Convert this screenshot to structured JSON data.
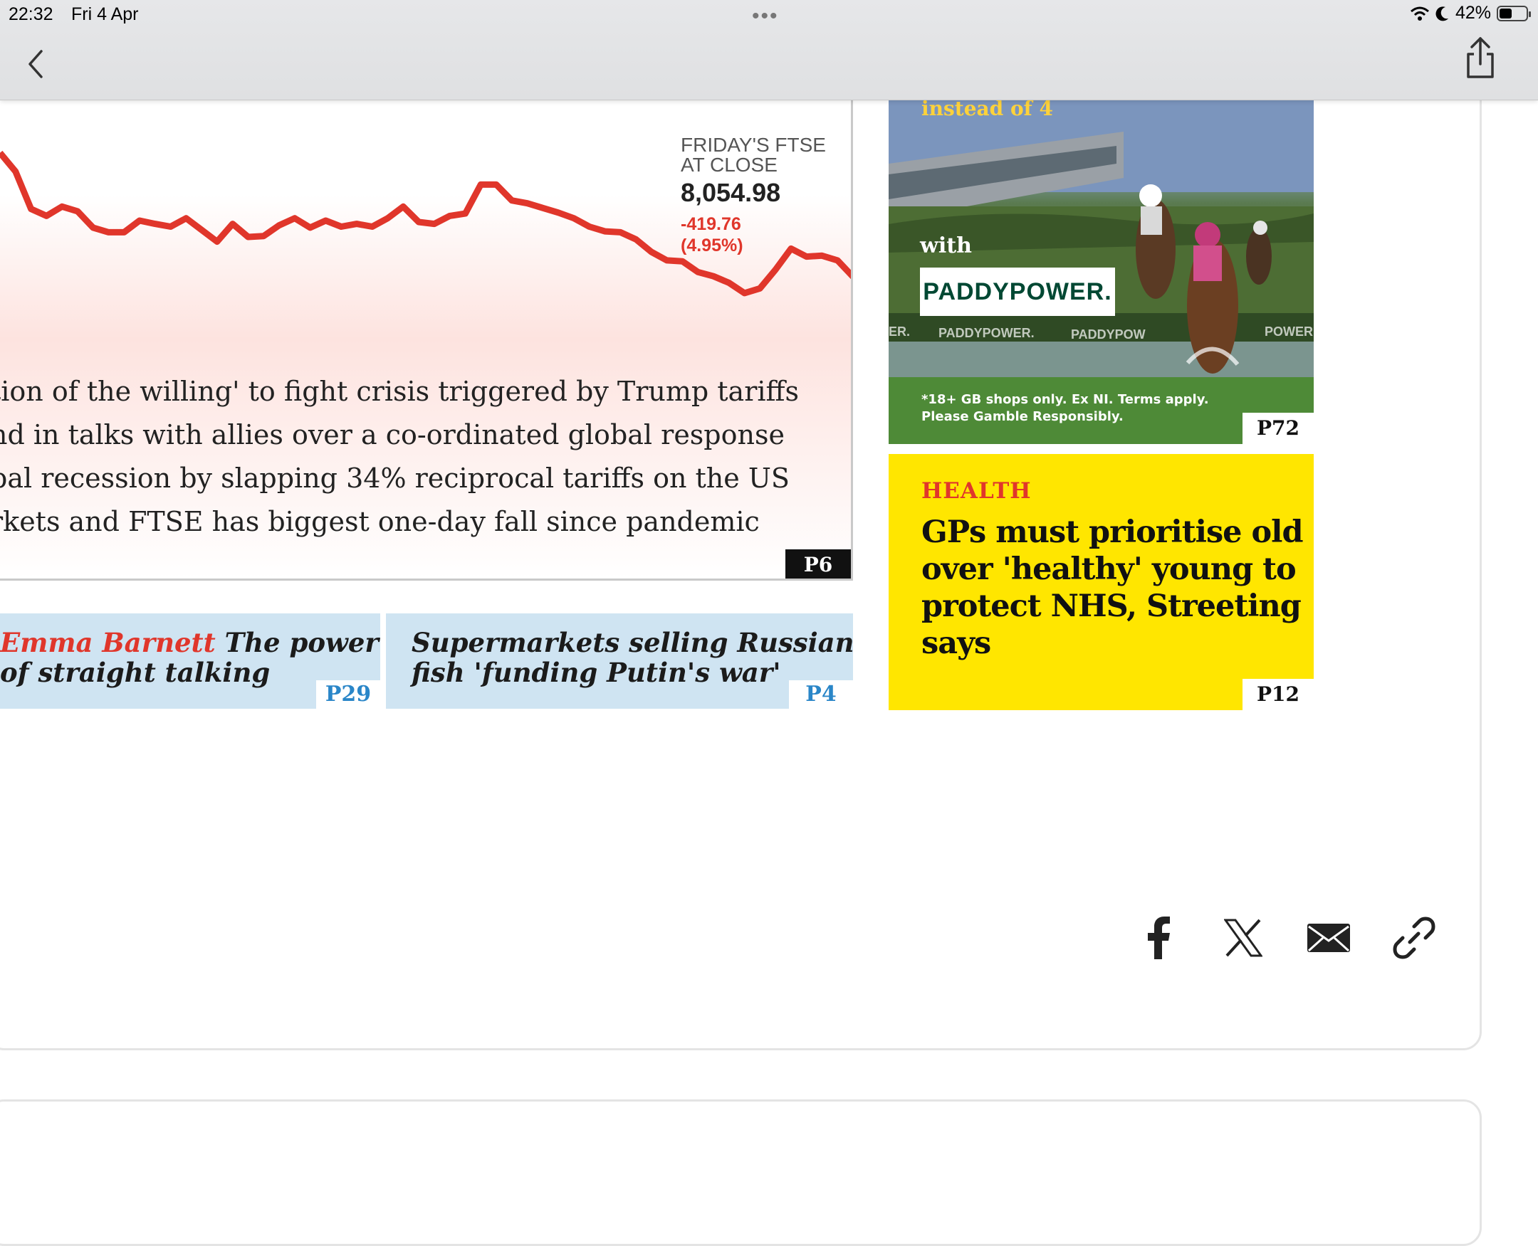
{
  "status_bar": {
    "time": "22:32",
    "date": "Fri 4 Apr",
    "battery": "42%",
    "battery_level": 0.42
  },
  "nav": {
    "back_icon": "chevron-left-icon",
    "share_icon": "share-icon"
  },
  "chart_panel": {
    "ftse_label": "FRIDAY'S FTSE AT CLOSE",
    "ftse_value": "8,054.98",
    "ftse_change": "-419.76",
    "ftse_change_pct": "(4.95%)",
    "line_color": "#e0362b",
    "story_lines": [
      "tion of the willing' to fight crisis triggered by Trump tariffs",
      "nd in talks with allies over a co-ordinated global response",
      "bal recession by slapping 34% reciprocal tariffs on the US",
      "rkets and FTSE has biggest one-day fall since pandemic"
    ],
    "page": "P6"
  },
  "chart_data": {
    "type": "line",
    "title": "",
    "xlabel": "",
    "ylabel": "",
    "series": [
      {
        "values": [
          8470,
          8430,
          8350,
          8335,
          8355,
          8345,
          8310,
          8300,
          8300,
          8325,
          8318,
          8312,
          8330,
          8305,
          8280,
          8318,
          8290,
          8292,
          8315,
          8330,
          8310,
          8325,
          8312,
          8318,
          8312,
          8330,
          8355,
          8322,
          8318,
          8335,
          8340,
          8402,
          8402,
          8368,
          8362,
          8352,
          8342,
          8330,
          8312,
          8302,
          8300,
          8285,
          8258,
          8240,
          8238,
          8215,
          8206,
          8192,
          8170,
          8180,
          8220,
          8265,
          8248,
          8250,
          8240,
          8205
        ]
      }
    ],
    "grid": false,
    "legend": "none"
  },
  "teasers": [
    {
      "author": "Emma Barnett",
      "text_1": "The power",
      "text_2": "of straight talking",
      "page": "P29"
    },
    {
      "text_1": "Supermarkets selling Russian",
      "text_2": "fish 'funding Putin's war'",
      "page": "P4"
    }
  ],
  "ad": {
    "headline": "instead of 4",
    "with": "with",
    "logo": "PADDYPOWER.",
    "logo_small_1": "PADDYPOWER.",
    "logo_small_2": "PADDYPOW",
    "logo_small_3": "POWER.",
    "logo_small_0": "ER.",
    "fine_1": "*18+ GB shops only. Ex NI. Terms apply.",
    "fine_2": "Please Gamble Responsibly.",
    "page": "P72"
  },
  "health": {
    "label": "HEALTH",
    "headline": "GPs must prioritise old over 'healthy' young to protect NHS, Streeting says",
    "page": "P12"
  },
  "share": [
    {
      "name": "facebook-icon"
    },
    {
      "name": "x-icon"
    },
    {
      "name": "email-icon"
    },
    {
      "name": "link-icon"
    }
  ]
}
